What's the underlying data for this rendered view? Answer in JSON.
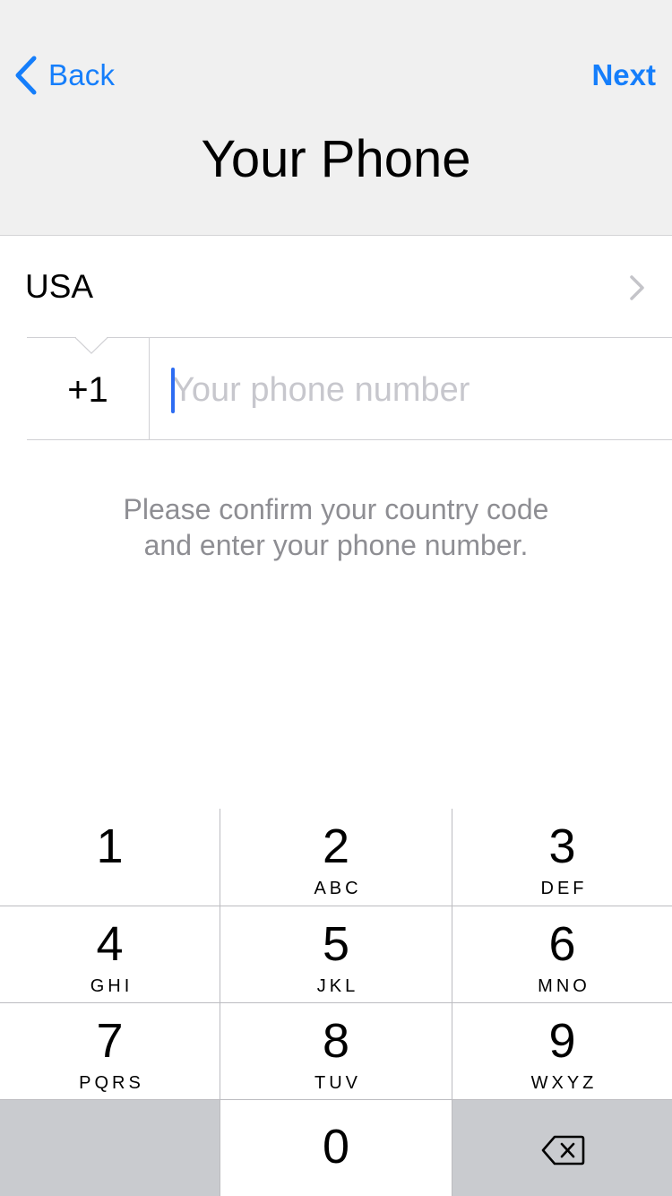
{
  "nav": {
    "back_label": "Back",
    "next_label": "Next",
    "title": "Your Phone"
  },
  "country": {
    "name": "USA",
    "code": "+1"
  },
  "phone": {
    "value": "",
    "placeholder": "Your phone number"
  },
  "hint": {
    "line1": "Please confirm your country code",
    "line2": "and enter your phone number."
  },
  "keypad": {
    "keys": [
      {
        "digit": "1",
        "letters": ""
      },
      {
        "digit": "2",
        "letters": "ABC"
      },
      {
        "digit": "3",
        "letters": "DEF"
      },
      {
        "digit": "4",
        "letters": "GHI"
      },
      {
        "digit": "5",
        "letters": "JKL"
      },
      {
        "digit": "6",
        "letters": "MNO"
      },
      {
        "digit": "7",
        "letters": "PQRS"
      },
      {
        "digit": "8",
        "letters": "TUV"
      },
      {
        "digit": "9",
        "letters": "WXYZ"
      },
      {
        "digit": "0",
        "letters": ""
      }
    ],
    "delete_icon": "backspace-icon"
  },
  "colors": {
    "accent": "#157efb",
    "caret": "#2d6cf2",
    "hint": "#8e8e93",
    "header_bg": "#f0f0f0",
    "key_dark": "#c9cbcf"
  }
}
